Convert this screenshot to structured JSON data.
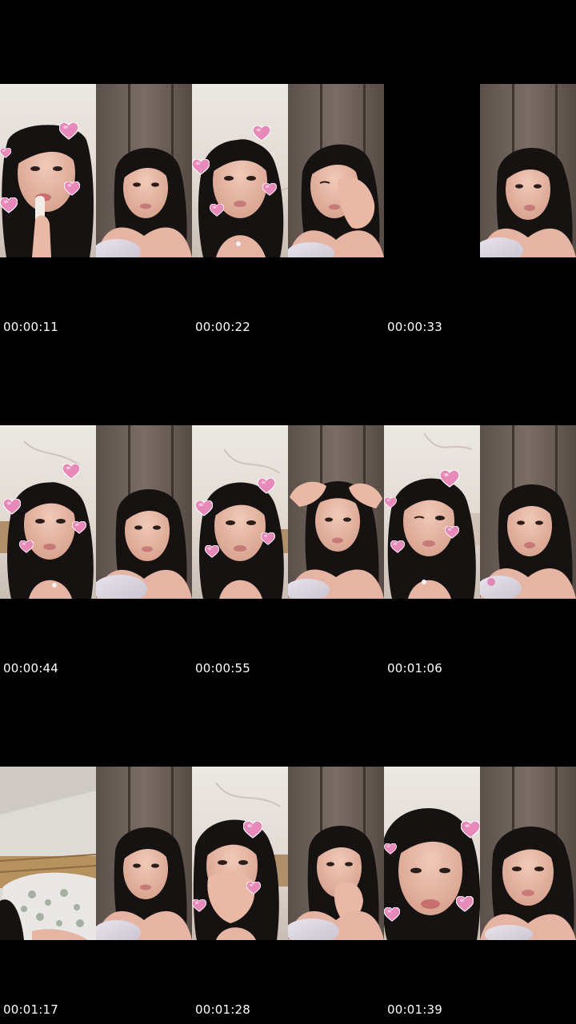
{
  "contact_sheet": {
    "background": "#000000",
    "rows": [
      {
        "timestamps": [
          "00:00:11",
          "00:00:22",
          "00:00:33"
        ],
        "frames": [
          {
            "scene": "bright-room",
            "pose": "lipstick",
            "hearts": true
          },
          {
            "scene": "dark-wall",
            "pose": "neutral",
            "hearts": false
          },
          {
            "scene": "bright-room",
            "pose": "neutral",
            "hearts": true
          },
          {
            "scene": "dark-wall",
            "pose": "hand-face",
            "hearts": false
          },
          {
            "scene": "blank",
            "pose": "none",
            "hearts": false
          },
          {
            "scene": "dark-wall",
            "pose": "neutral",
            "hearts": false
          }
        ]
      },
      {
        "timestamps": [
          "00:00:44",
          "00:00:55",
          "00:01:06"
        ],
        "frames": [
          {
            "scene": "bright-room",
            "pose": "neutral",
            "hearts": true
          },
          {
            "scene": "dark-wall",
            "pose": "neutral",
            "hearts": false
          },
          {
            "scene": "bright-room",
            "pose": "neutral",
            "hearts": true
          },
          {
            "scene": "dark-wall",
            "pose": "hands-head",
            "hearts": false
          },
          {
            "scene": "bright-room",
            "pose": "neutral",
            "hearts": true
          },
          {
            "scene": "dark-wall",
            "pose": "neutral",
            "hearts": false
          }
        ]
      },
      {
        "timestamps": [
          "00:01:17",
          "00:01:28",
          "00:01:39"
        ],
        "frames": [
          {
            "scene": "bright-room",
            "pose": "bed-pillow",
            "hearts": false
          },
          {
            "scene": "dark-wall",
            "pose": "neutral",
            "hearts": false
          },
          {
            "scene": "bright-room",
            "pose": "hand-face",
            "hearts": true
          },
          {
            "scene": "dark-wall",
            "pose": "hand-face",
            "hearts": false
          },
          {
            "scene": "bright-room",
            "pose": "closeup",
            "hearts": true
          },
          {
            "scene": "dark-wall",
            "pose": "neutral",
            "hearts": false
          }
        ]
      }
    ],
    "colors": {
      "bright_wall": "#e7e2dc",
      "dark_wall": "#6b5f57",
      "skin": "#e7b8a6",
      "hair": "#161212",
      "heart": "#e88ab9",
      "timestamp": "#ffffff"
    }
  }
}
